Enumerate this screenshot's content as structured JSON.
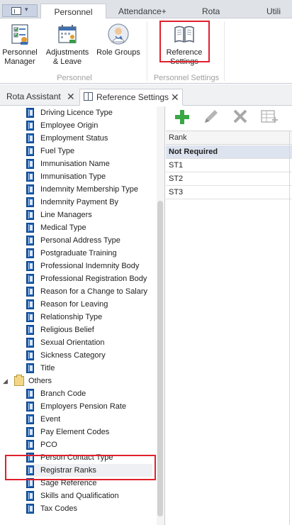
{
  "ribbon": {
    "tabs": [
      {
        "label": "Personnel",
        "active": true
      },
      {
        "label": "Attendance+",
        "active": false
      },
      {
        "label": "Rota",
        "active": false
      },
      {
        "label": "Utili",
        "active": false
      }
    ],
    "buttons": [
      {
        "label_line1": "Personnel",
        "label_line2": "Manager",
        "icon": "checklist-icon"
      },
      {
        "label_line1": "Adjustments",
        "label_line2": "& Leave",
        "icon": "calendar-people-icon"
      },
      {
        "label_line1": "Role Groups",
        "label_line2": "",
        "icon": "doctor-group-icon"
      },
      {
        "label_line1": "Reference",
        "label_line2": "Settings",
        "icon": "book-icon"
      }
    ],
    "groups": [
      "Personnel",
      "Personnel Settings"
    ]
  },
  "doc_tabs": [
    {
      "label": "Rota Assistant",
      "active": false
    },
    {
      "label": "Reference Settings",
      "active": true
    }
  ],
  "tree": {
    "items_top": [
      "Driving Licence Type",
      "Employee Origin",
      "Employment Status",
      "Fuel Type",
      "Immunisation Name",
      "Immunisation Type",
      "Indemnity Membership Type",
      "Indemnity Payment By",
      "Line Managers",
      "Medical Type",
      "Personal Address Type",
      "Postgraduate Training",
      "Professional Indemnity Body",
      "Professional Registration Body",
      "Reason for a Change to Salary",
      "Reason for Leaving",
      "Relationship Type",
      "Religious Belief",
      "Sexual Orientation",
      "Sickness Category",
      "Title"
    ],
    "group_label": "Others",
    "items_others": [
      "Branch Code",
      "Employers Pension Rate",
      "Event",
      "Pay Element Codes",
      "PCO",
      "Person Contact Type",
      "Registrar Ranks",
      "Sage Reference",
      "Skills and Qualification",
      "Tax Codes"
    ],
    "selected_item": "Registrar Ranks"
  },
  "grid": {
    "toolbar": [
      "add-icon",
      "edit-icon",
      "delete-icon",
      "grid-add-icon"
    ],
    "column_header": "Rank",
    "rows": [
      "Not Required",
      "ST1",
      "ST2",
      "ST3"
    ],
    "selected_row": "Not Required"
  },
  "colors": {
    "highlight_box": "#e0202c",
    "book_blue": "#1860b8",
    "add_green": "#3aa745",
    "selected_row": "#dde3ef"
  }
}
